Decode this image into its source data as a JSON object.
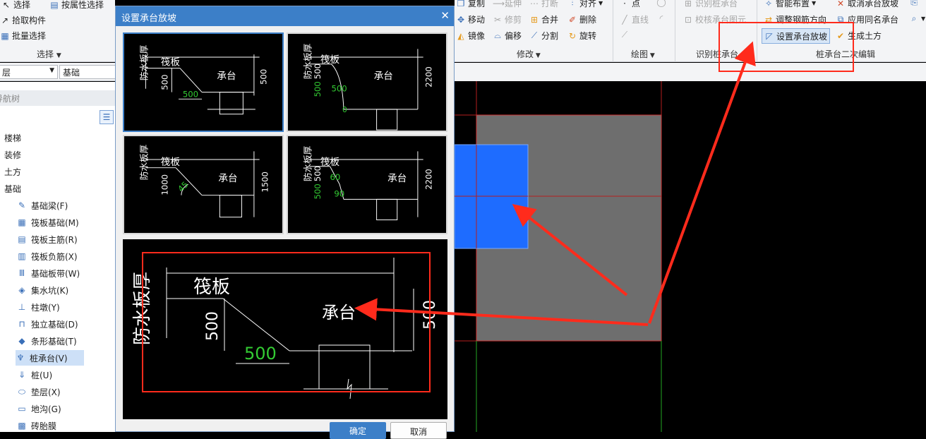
{
  "left_ribbon": {
    "select_label": "选择",
    "by_attr_label": "按属性选择",
    "pick_label": "拾取构件",
    "batch_label": "批量选择",
    "group_label": "选择"
  },
  "combos": {
    "layer": "层",
    "type": "基础"
  },
  "nav": {
    "header": "导航树",
    "categories": [
      "楼梯",
      "装修",
      "土方",
      "基础"
    ],
    "items": [
      {
        "label": "基础梁(F)",
        "icon": "pencil-icon"
      },
      {
        "label": "筏板基础(M)",
        "icon": "grid-icon"
      },
      {
        "label": "筏板主筋(R)",
        "icon": "grid-icon"
      },
      {
        "label": "筏板负筋(X)",
        "icon": "grid-icon"
      },
      {
        "label": "基础板带(W)",
        "icon": "grid-icon"
      },
      {
        "label": "集水坑(K)",
        "icon": "pit-icon"
      },
      {
        "label": "柱墩(Y)",
        "icon": "pier-icon"
      },
      {
        "label": "独立基础(D)",
        "icon": "footing-icon"
      },
      {
        "label": "条形基础(T)",
        "icon": "strip-icon"
      },
      {
        "label": "桩承台(V)",
        "icon": "cap-icon"
      },
      {
        "label": "桩(U)",
        "icon": "pile-icon"
      },
      {
        "label": "垫层(X)",
        "icon": "cushion-icon"
      },
      {
        "label": "地沟(G)",
        "icon": "trench-icon"
      },
      {
        "label": "砖胎膜",
        "icon": "brick-icon"
      }
    ]
  },
  "dialog": {
    "title": "设置承台放坡",
    "ok_label": "确定",
    "cancel_label": "取消",
    "thumb_labels": {
      "waterproof": "防水板厚",
      "raft": "筏板",
      "cap": "承台"
    },
    "thumbs": [
      {
        "side_dim": "500",
        "bottom_dim": "500",
        "right_dim": "500"
      },
      {
        "side_dim": "500",
        "upper_dim": "500",
        "slope_dim": "500",
        "zero": "0",
        "right_dim": "2200"
      },
      {
        "side_dim": "1000",
        "angle": "45",
        "right_dim": "1500"
      },
      {
        "side_dim": "500",
        "upper_dim": "500",
        "angle_upper": "60",
        "angle_lower": "90",
        "right_dim": "2200"
      }
    ],
    "preview": {
      "waterproof": "防水板厚",
      "raft": "筏板",
      "cap": "承台",
      "depth": "500",
      "width": "500",
      "right_dim": "500"
    }
  },
  "right_ribbon": {
    "copy": "复制",
    "extend": "延伸",
    "break": "打断",
    "align": "对齐",
    "move": "移动",
    "trim": "修剪",
    "merge": "合并",
    "delete": "删除",
    "mirror": "镜像",
    "offset": "偏移",
    "split": "分割",
    "rotate": "旋转",
    "modify_group": "修改",
    "point": "点",
    "line": "直线",
    "draw_group": "绘图",
    "identify_cap": "识别桩承台",
    "check_cap": "校核承台图元",
    "identify_group": "识别桩承台",
    "smart_layout": "智能布置",
    "adjust_rebar": "调整钢筋方向",
    "set_slope": "设置承台放坡",
    "cancel_slope": "取消承台放坡",
    "apply_same": "应用同名承台",
    "gen_earthwork": "生成土方",
    "edit_group": "桩承台二次编辑"
  },
  "colors": {
    "accent": "#3c7fc8",
    "annotation": "#ff2b1c",
    "cad_green": "#33cc33",
    "cap_blue": "#1e6cff",
    "cap_gray": "#6e6e6e"
  }
}
